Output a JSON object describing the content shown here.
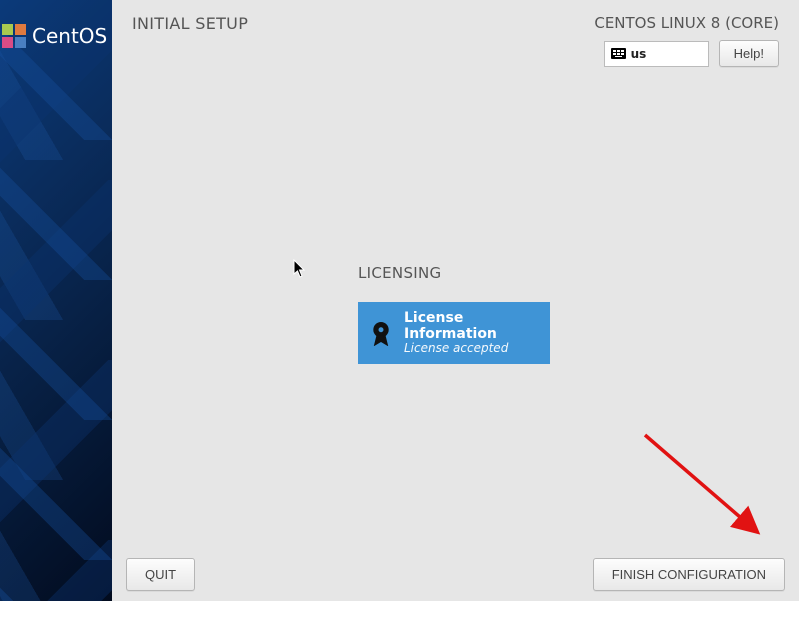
{
  "sidebar": {
    "brand": "CentOS"
  },
  "header": {
    "title": "INITIAL SETUP",
    "distro": "CENTOS LINUX 8 (CORE)",
    "keyboard_layout": "us",
    "help_label": "Help!"
  },
  "licensing": {
    "heading": "LICENSING",
    "spoke_title": "License Information",
    "spoke_status": "License accepted"
  },
  "footer": {
    "quit_label": "QUIT",
    "finish_label": "FINISH CONFIGURATION"
  },
  "colors": {
    "spoke_bg": "#3f94d6",
    "panel_bg": "#e6e6e6",
    "arrow": "#e11212"
  }
}
